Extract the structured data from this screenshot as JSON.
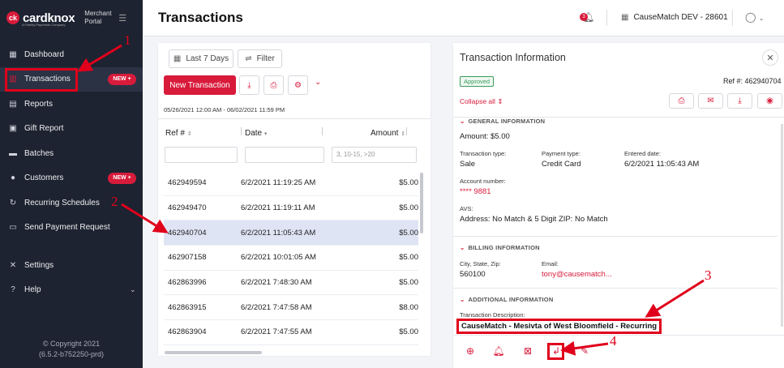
{
  "brand": {
    "name": "cardknox",
    "tagline": "A Fidelity Payments Company",
    "portal_label": "Merchant Portal"
  },
  "sidebar": {
    "items": [
      {
        "label": "Dashboard",
        "icon": "dashboard-icon"
      },
      {
        "label": "Transactions",
        "icon": "transactions-icon",
        "badge": "NEW +"
      },
      {
        "label": "Reports",
        "icon": "reports-icon"
      },
      {
        "label": "Gift Report",
        "icon": "gift-icon"
      },
      {
        "label": "Batches",
        "icon": "batches-icon"
      },
      {
        "label": "Customers",
        "icon": "customers-icon",
        "badge": "NEW +"
      },
      {
        "label": "Recurring Schedules",
        "icon": "recurring-icon"
      },
      {
        "label": "Send Payment Request",
        "icon": "send-payment-icon"
      },
      {
        "label": "Settings",
        "icon": "settings-icon"
      },
      {
        "label": "Help",
        "icon": "help-icon"
      }
    ],
    "copyright": "© Copyright 2021",
    "version": "(6.5.2-b752250-prd)"
  },
  "header": {
    "title": "Transactions",
    "notification_count": "3",
    "account": "CauseMatch DEV - 28601"
  },
  "toolbar": {
    "last_7_days": "Last 7 Days",
    "filter": "Filter",
    "new_transaction": "New Transaction",
    "date_range": "05/26/2021 12:00 AM - 06/02/2021 11:59 PM"
  },
  "table": {
    "columns": [
      "Ref #",
      "Date",
      "Amount"
    ],
    "amount_placeholder": "3, 10-15, >20",
    "rows": [
      {
        "ref": "462949594",
        "date": "6/2/2021 11:19:25 AM",
        "amount": "$5.00"
      },
      {
        "ref": "462949470",
        "date": "6/2/2021 11:19:11 AM",
        "amount": "$5.00"
      },
      {
        "ref": "462940704",
        "date": "6/2/2021 11:05:43 AM",
        "amount": "$5.00"
      },
      {
        "ref": "462907158",
        "date": "6/2/2021 10:01:05 AM",
        "amount": "$5.00"
      },
      {
        "ref": "462863996",
        "date": "6/2/2021 7:48:30 AM",
        "amount": "$5.00"
      },
      {
        "ref": "462863915",
        "date": "6/2/2021 7:47:58 AM",
        "amount": "$8.00"
      },
      {
        "ref": "462863904",
        "date": "6/2/2021 7:47:55 AM",
        "amount": "$5.00"
      }
    ],
    "selected_index": 2
  },
  "detail": {
    "title": "Transaction Information",
    "status": "Approved",
    "ref": "Ref #: 462940704",
    "collapse_all": "Collapse all",
    "general": {
      "heading": "GENERAL INFORMATION",
      "amount": "Amount: $5.00",
      "type_label": "Transaction type:",
      "type_value": "Sale",
      "payment_label": "Payment type:",
      "payment_value": "Credit Card",
      "entered_label": "Entered date:",
      "entered_value": "6/2/2021 11:05:43 AM",
      "account_label": "Account number:",
      "account_value": "**** 9881",
      "avs_label": "AVS:",
      "avs_value": "Address: No Match & 5 Digit ZIP: No Match"
    },
    "billing": {
      "heading": "BILLING INFORMATION",
      "city_label": "City, State, Zip:",
      "city_value": "560100",
      "email_label": "Email:",
      "email_value": "tony@causematch..."
    },
    "additional": {
      "heading": "ADDITIONAL INFORMATION",
      "desc_label": "Transaction Description:",
      "desc_value": "CauseMatch - Mesivta of West Bloomfield - Recurring"
    }
  },
  "annotations": [
    "1",
    "2",
    "3",
    "4"
  ],
  "colors": {
    "accent": "#d81b3b",
    "sidebar": "#1d2331",
    "annotation": "#e0001b"
  }
}
